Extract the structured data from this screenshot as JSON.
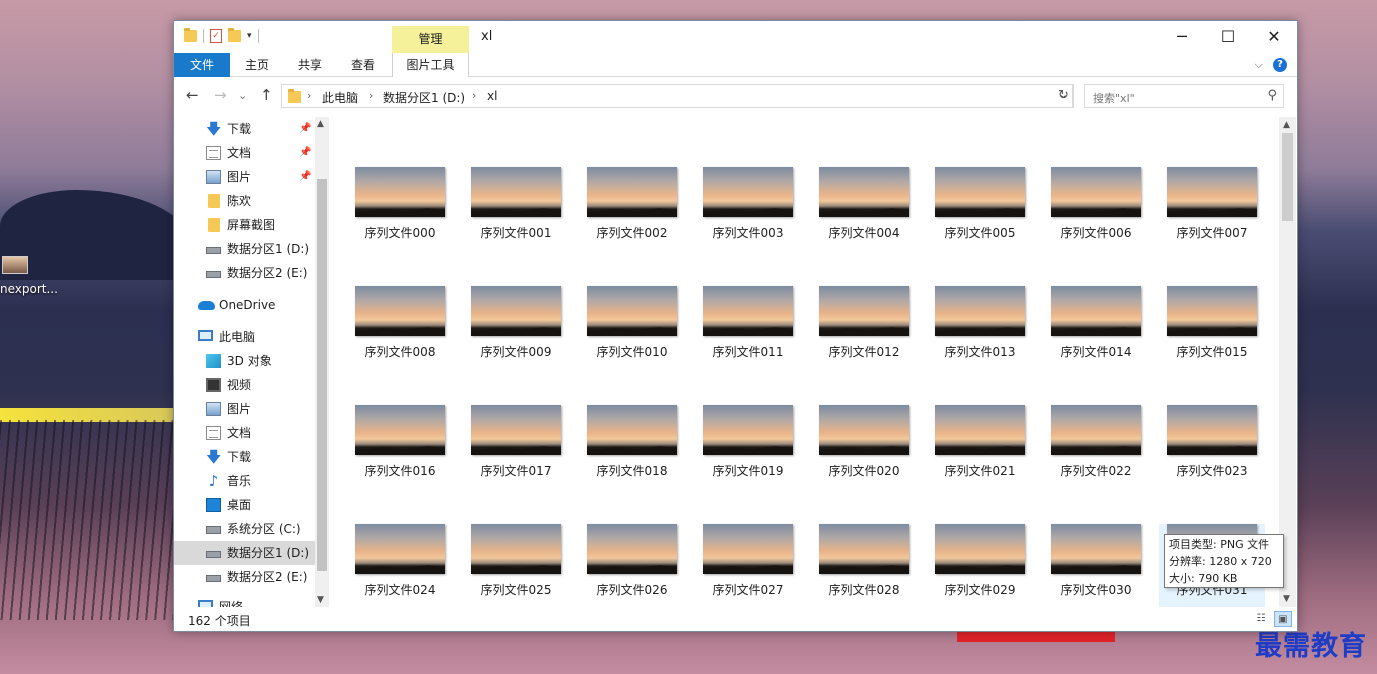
{
  "desktop": {
    "icon_label": "nexport..."
  },
  "watermark": "最需教育",
  "window": {
    "title": "xl",
    "quick_access_dropdown": "▾",
    "contextual_tab_group": "管理",
    "controls": {
      "minimize": "─",
      "maximize": "☐",
      "close": "✕"
    }
  },
  "ribbon": {
    "tabs": [
      "文件",
      "主页",
      "共享",
      "查看",
      "图片工具"
    ],
    "expand": "⌵",
    "help": "?"
  },
  "nav": {
    "back": "←",
    "forward": "→",
    "recent": "⌄",
    "up": "↑",
    "breadcrumb": [
      "此电脑",
      "数据分区1 (D:)",
      "xl"
    ],
    "separator": "›",
    "dropdown": "⌄",
    "refresh": "↻",
    "search_placeholder": "搜索\"xl\"",
    "search_icon": "⚲"
  },
  "sidebar": {
    "items": [
      {
        "label": "下载",
        "icon": "download-icon",
        "pinned": true
      },
      {
        "label": "文档",
        "icon": "document-icon",
        "pinned": true
      },
      {
        "label": "图片",
        "icon": "picture-icon",
        "pinned": true
      },
      {
        "label": "陈欢",
        "icon": "folder-icon"
      },
      {
        "label": "屏幕截图",
        "icon": "folder-icon"
      },
      {
        "label": "数据分区1 (D:)",
        "icon": "drive-icon"
      },
      {
        "label": "数据分区2 (E:)",
        "icon": "drive-icon"
      },
      {
        "label": "OneDrive",
        "icon": "onedrive-icon"
      },
      {
        "label": "此电脑",
        "icon": "this-pc-icon"
      },
      {
        "label": "3D 对象",
        "icon": "3d-objects-icon"
      },
      {
        "label": "视频",
        "icon": "video-icon"
      },
      {
        "label": "图片",
        "icon": "picture-icon"
      },
      {
        "label": "文档",
        "icon": "document-icon"
      },
      {
        "label": "下载",
        "icon": "download-icon"
      },
      {
        "label": "音乐",
        "icon": "music-icon"
      },
      {
        "label": "桌面",
        "icon": "desktop-icon"
      },
      {
        "label": "系统分区 (C:)",
        "icon": "system-drive-icon"
      },
      {
        "label": "数据分区1 (D:)",
        "icon": "drive-icon",
        "selected": true
      },
      {
        "label": "数据分区2 (E:)",
        "icon": "drive-icon"
      },
      {
        "label": "网络",
        "icon": "network-icon"
      }
    ],
    "pin_glyph": "📌",
    "scroll_up": "▲",
    "scroll_down": "▼"
  },
  "files": [
    "序列文件000",
    "序列文件001",
    "序列文件002",
    "序列文件003",
    "序列文件004",
    "序列文件005",
    "序列文件006",
    "序列文件007",
    "序列文件008",
    "序列文件009",
    "序列文件010",
    "序列文件011",
    "序列文件012",
    "序列文件013",
    "序列文件014",
    "序列文件015",
    "序列文件016",
    "序列文件017",
    "序列文件018",
    "序列文件019",
    "序列文件020",
    "序列文件021",
    "序列文件022",
    "序列文件023",
    "序列文件024",
    "序列文件025",
    "序列文件026",
    "序列文件027",
    "序列文件028",
    "序列文件029",
    "序列文件030",
    "序列文件031"
  ],
  "content_scroll": {
    "up": "▲",
    "down": "▼"
  },
  "tooltip": {
    "type": "项目类型: PNG 文件",
    "resolution": "分辨率: 1280 x 720",
    "size": "大小: 790 KB"
  },
  "status": {
    "count": "162 个项目",
    "details_view": "☷",
    "large_icons_view": "▣"
  }
}
